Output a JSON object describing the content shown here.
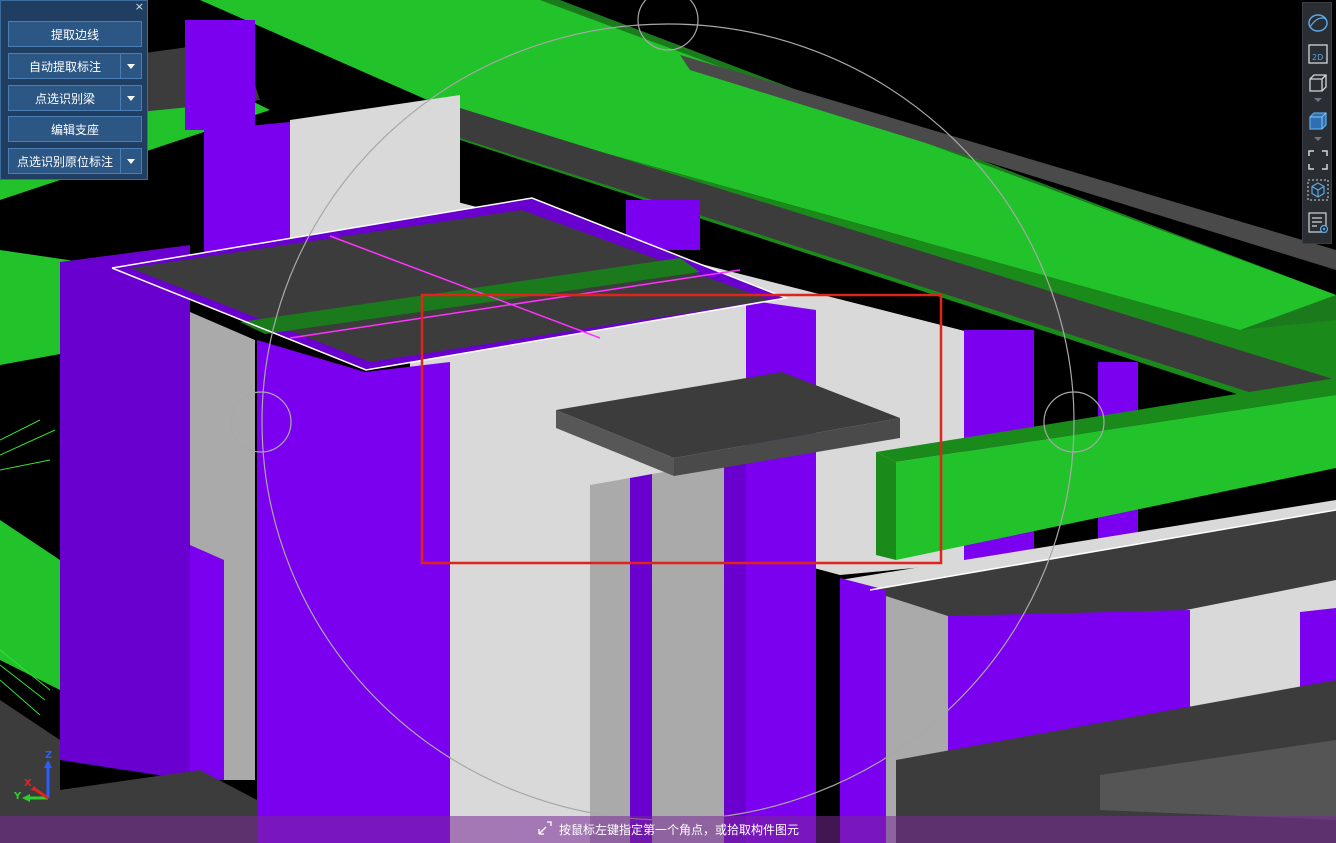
{
  "panel": {
    "close_label": "×",
    "buttons": [
      {
        "label": "提取边线",
        "has_dropdown": false
      },
      {
        "label": "自动提取标注",
        "has_dropdown": true
      },
      {
        "label": "点选识别梁",
        "has_dropdown": true
      },
      {
        "label": "编辑支座",
        "has_dropdown": false
      },
      {
        "label": "点选识别原位标注",
        "has_dropdown": true
      }
    ]
  },
  "toolbar": {
    "icons": [
      "orbit-icon",
      "view-2d-icon",
      "box-wireframe-icon",
      "box-solid-icon",
      "zoom-extents-icon",
      "cube-select-icon",
      "layer-list-icon"
    ],
    "view_2d_label": "2D"
  },
  "status": {
    "prompt": "按鼠标左键指定第一个角点，或拾取构件图元",
    "icon": "cursor-corner-icon"
  },
  "axis": {
    "z": "Z",
    "x": "X",
    "y": "Y"
  },
  "colors": {
    "beam_green": "#22c22a",
    "column_purple": "#7b00f0",
    "slab_dark": "#3c3c3c",
    "wall_light": "#d9d9d9",
    "selection_red": "#e0241b",
    "panel_bg": "#1f3e62",
    "button_bg": "#2c5785"
  }
}
